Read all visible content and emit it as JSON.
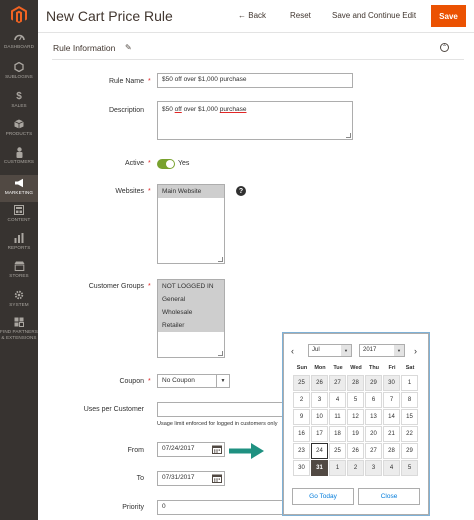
{
  "sidebar": {
    "items": [
      {
        "label": "DASHBOARD",
        "icon": "dashboard-icon"
      },
      {
        "label": "SUBLOGINS",
        "icon": "hexagon-icon"
      },
      {
        "label": "SALES",
        "icon": "dollar-icon"
      },
      {
        "label": "PRODUCTS",
        "icon": "box-icon"
      },
      {
        "label": "CUSTOMERS",
        "icon": "person-icon"
      },
      {
        "label": "MARKETING",
        "icon": "megaphone-icon"
      },
      {
        "label": "CONTENT",
        "icon": "layout-icon"
      },
      {
        "label": "REPORTS",
        "icon": "bar-chart-icon"
      },
      {
        "label": "STORES",
        "icon": "store-icon"
      },
      {
        "label": "SYSTEM",
        "icon": "gear-icon"
      },
      {
        "label": "FIND PARTNERS & EXTENSIONS",
        "icon": "extensions-icon"
      }
    ],
    "active": "MARKETING"
  },
  "header": {
    "title": "New Cart Price Rule",
    "back_label": "Back",
    "reset_label": "Reset",
    "save_continue_label": "Save and Continue Edit",
    "save_label": "Save"
  },
  "section": {
    "title": "Rule Information"
  },
  "form": {
    "rule_name": {
      "label": "Rule Name",
      "value": "$50 off over $1,000 purchase"
    },
    "description": {
      "label": "Description",
      "value_prefix": "$50 ",
      "value_u1": "off",
      "value_mid": " over $1,000 ",
      "value_u2": "purchase"
    },
    "active": {
      "label": "Active",
      "value": "Yes"
    },
    "websites": {
      "label": "Websites",
      "options": [
        "Main Website"
      ]
    },
    "customer_groups": {
      "label": "Customer Groups",
      "options": [
        "NOT LOGGED IN",
        "General",
        "Wholesale",
        "Retailer"
      ]
    },
    "coupon": {
      "label": "Coupon",
      "value": "No Coupon"
    },
    "uses_per_customer": {
      "label": "Uses per Customer",
      "value": "",
      "note": "Usage limit enforced for logged in customers only"
    },
    "from": {
      "label": "From",
      "value": "07/24/2017"
    },
    "to": {
      "label": "To",
      "value": "07/31/2017"
    },
    "priority": {
      "label": "Priority",
      "value": "0"
    }
  },
  "datepicker": {
    "month": "Jul",
    "year": "2017",
    "dow": [
      "Sun",
      "Mon",
      "Tue",
      "Wed",
      "Thu",
      "Fri",
      "Sat"
    ],
    "weeks": [
      [
        "25",
        "26",
        "27",
        "28",
        "29",
        "30",
        "1"
      ],
      [
        "2",
        "3",
        "4",
        "5",
        "6",
        "7",
        "8"
      ],
      [
        "9",
        "10",
        "11",
        "12",
        "13",
        "14",
        "15"
      ],
      [
        "16",
        "17",
        "18",
        "19",
        "20",
        "21",
        "22"
      ],
      [
        "23",
        "24",
        "25",
        "26",
        "27",
        "28",
        "29"
      ],
      [
        "30",
        "31",
        "1",
        "2",
        "3",
        "4",
        "5"
      ]
    ],
    "go_today_label": "Go Today",
    "close_label": "Close"
  },
  "colors": {
    "accent": "#eb5202",
    "sidebar": "#373330",
    "toggle": "#79a22e",
    "link": "#007bdb",
    "arrow": "#1f9181"
  }
}
